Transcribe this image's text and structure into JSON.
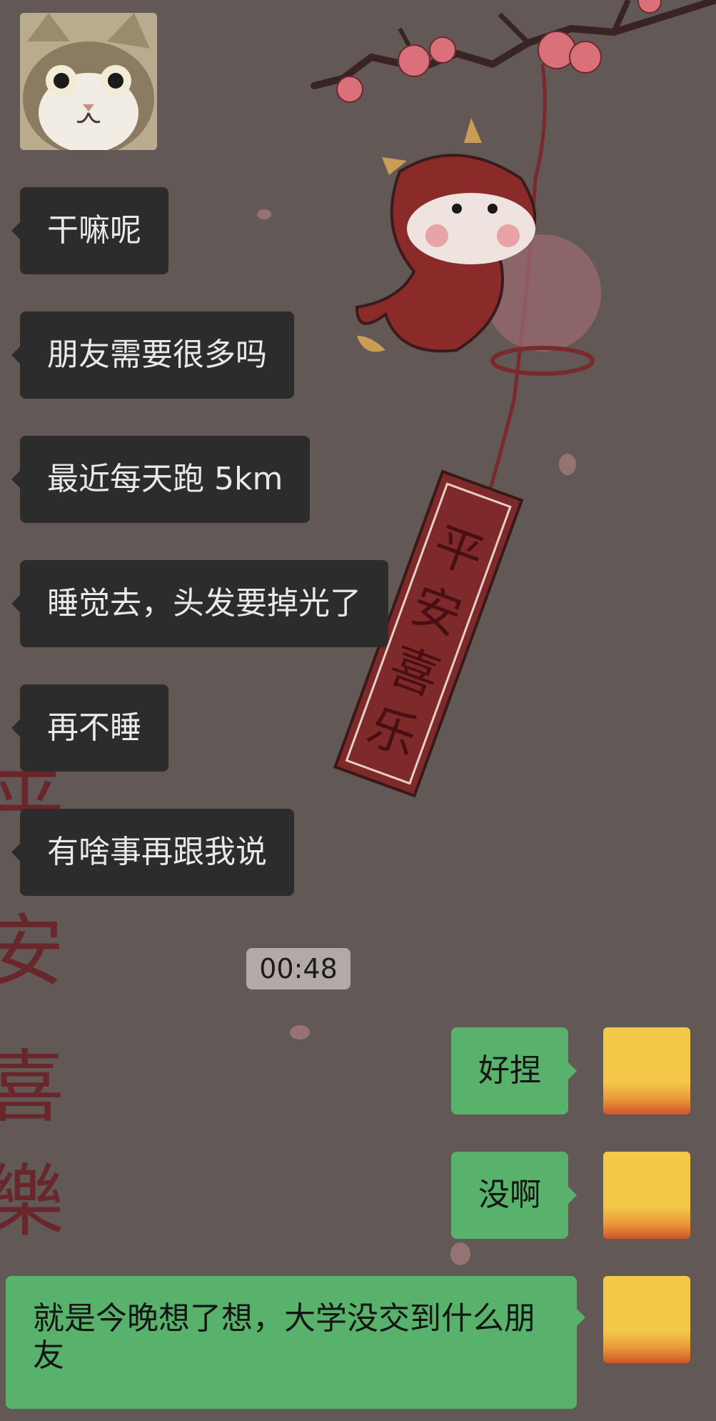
{
  "chat": {
    "incoming": [
      {
        "text": "干嘛呢"
      },
      {
        "text": "朋友需要很多吗"
      },
      {
        "text": "最近每天跑 5km"
      },
      {
        "text": "睡觉去，头发要掉光了"
      },
      {
        "text": "再不睡"
      },
      {
        "text": "有啥事再跟我说"
      }
    ],
    "timestamp": "00:48",
    "outgoing": [
      {
        "text": "好捏"
      },
      {
        "text": "没啊"
      },
      {
        "text": "就是今晚想了想，大学没交到什么朋友"
      }
    ]
  },
  "wallpaper": {
    "charm_text": "平安喜乐",
    "side_text": "平安喜樂"
  },
  "colors": {
    "background": "#625855",
    "incoming_bubble": "#2c2c2c",
    "outgoing_bubble": "#58b26b",
    "timestamp_bg": "#b3aaa7"
  },
  "icons": {
    "cat_avatar": "cat-avatar-icon",
    "self_avatar": "yellow-gradient-avatar"
  }
}
